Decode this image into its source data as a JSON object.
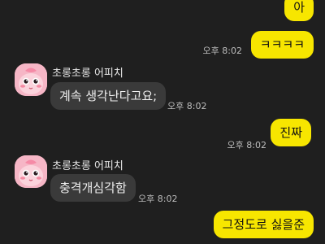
{
  "messages": [
    {
      "from": "me",
      "text": "아"
    },
    {
      "from": "me",
      "text": "ㅋㅋㅋㅋ",
      "time": "오후 8:02"
    },
    {
      "from": "them",
      "sender": "초롱초롱 어피치",
      "text": "계속 생각난다고요;",
      "time": "오후 8:02",
      "avatar": "apeach-avatar"
    },
    {
      "from": "me",
      "text": "진짜",
      "time": "오후 8:02"
    },
    {
      "from": "them",
      "sender": "초롱초롱 어피치",
      "text": "충격개심각함",
      "time": "오후 8:02",
      "avatar": "apeach-avatar"
    },
    {
      "from": "me",
      "text": "그정도로 싫을준"
    }
  ],
  "colors": {
    "background": "#1f1f1f",
    "my_bubble": "#f7e600",
    "their_bubble": "#3a3a3a"
  }
}
